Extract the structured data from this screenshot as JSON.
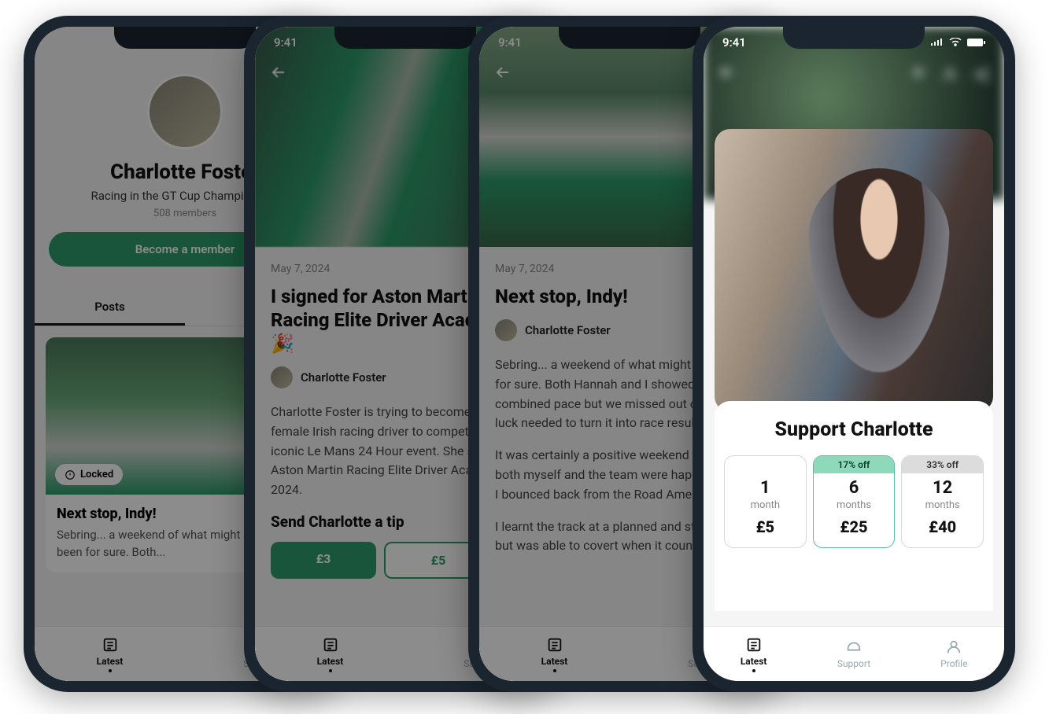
{
  "status": {
    "time": "9:41"
  },
  "nav": {
    "latest": "Latest",
    "support": "Support",
    "profile": "Profile"
  },
  "phone1": {
    "name": "Charlotte Foster",
    "tagline": "Racing in the GT Cup Championship",
    "members": "508 members",
    "cta": "Become a member",
    "tab_posts": "Posts",
    "locked": "Locked",
    "post_title": "Next stop, Indy!",
    "post_excerpt": "Sebring... a weekend of what might should have been for sure. Both..."
  },
  "phone2": {
    "date": "May 7, 2024",
    "title": "I signed for Aston Martin Racing Elite Driver Academy! 🎉",
    "author": "Charlotte Foster",
    "body": "Charlotte Foster is trying to become the first female Irish racing driver to compete at the iconic Le Mans 24 Hour event. She signed to the Aston Martin Racing Elite Driver Academy for 2024.",
    "tip_title": "Send Charlotte a tip",
    "tip1": "£3",
    "tip2": "£5"
  },
  "phone3": {
    "date": "May 7, 2024",
    "title": "Next stop, Indy!",
    "author": "Charlotte Foster",
    "body1": "Sebring... a weekend of what might have been for sure. Both Hannah and I showed great combined pace but we missed out on that bit of luck needed to turn it into race results.",
    "body2": "It was certainly a positive weekend though, and both myself and the team were happy with how I bounced back from the Road America blip.",
    "body3": "I learnt the track at a planned and steady pace but was able to covert when it counted."
  },
  "phone4": {
    "support_title": "Support Charlotte",
    "plans": [
      {
        "badge": "",
        "num": "1",
        "unit": "month",
        "price": "£5"
      },
      {
        "badge": "17% off",
        "num": "6",
        "unit": "months",
        "price": "£25"
      },
      {
        "badge": "33% off",
        "num": "12",
        "unit": "months",
        "price": "£40"
      }
    ]
  }
}
